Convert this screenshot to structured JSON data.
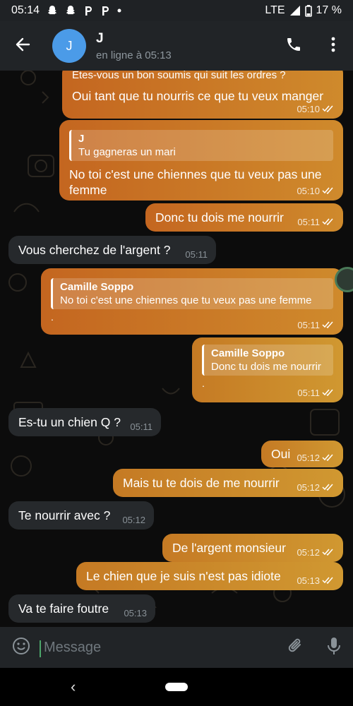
{
  "status_bar": {
    "time": "05:14",
    "network": "LTE",
    "battery": "17 %"
  },
  "header": {
    "avatar_letter": "J",
    "name": "J",
    "status": "en ligne à 05:13"
  },
  "messages": [
    {
      "dir": "out",
      "reply_text": "Etes-vous un bon soumis qui suit les ordres ?",
      "text": "Oui tant que tu nourris ce que tu veux manger",
      "time": "05:10"
    },
    {
      "dir": "out",
      "reply_name": "J",
      "reply_text": "Tu gagneras un mari",
      "text_line1": "No toi c'est une chiennes que tu veux pas une",
      "text_line2": "femme",
      "time": "05:10"
    },
    {
      "dir": "out",
      "text": "Donc tu dois me nourrir",
      "time": "05:11"
    },
    {
      "dir": "in",
      "text": "Vous cherchez de l'argent ?",
      "time": "05:11"
    },
    {
      "dir": "out",
      "reply_name": "Camille Soppo",
      "reply_text": "No toi c'est une chiennes que tu veux pas une femme",
      "text": ".",
      "time": "05:11"
    },
    {
      "dir": "out",
      "reply_name": "Camille Soppo",
      "reply_text": "Donc tu dois me nourrir",
      "text": ".",
      "time": "05:11"
    },
    {
      "dir": "in",
      "text": "Es-tu un chien Q ?",
      "time": "05:11"
    },
    {
      "dir": "out",
      "text": "Oui",
      "time": "05:12"
    },
    {
      "dir": "out",
      "text": "Mais tu te dois de me nourrir",
      "time": "05:12"
    },
    {
      "dir": "in",
      "text": "Te nourrir avec ?",
      "time": "05:12"
    },
    {
      "dir": "out",
      "text": "De l'argent monsieur",
      "time": "05:12"
    },
    {
      "dir": "out",
      "text": "Le chien que je suis n'est pas idiote",
      "time": "05:13"
    },
    {
      "dir": "in",
      "text": "Va te faire foutre",
      "time": "05:13"
    }
  ],
  "composer": {
    "placeholder": "Message"
  },
  "icons": {
    "back": "arrow-left-icon",
    "call": "phone-icon",
    "menu": "more-vert-icon",
    "emoji": "emoji-icon",
    "attach": "paperclip-icon",
    "mic": "microphone-icon",
    "read": "double-check-icon"
  },
  "colors": {
    "outgoing": "#c9782a",
    "incoming": "#26292c",
    "avatar": "#4b9be8",
    "background": "#0c0c0c"
  }
}
